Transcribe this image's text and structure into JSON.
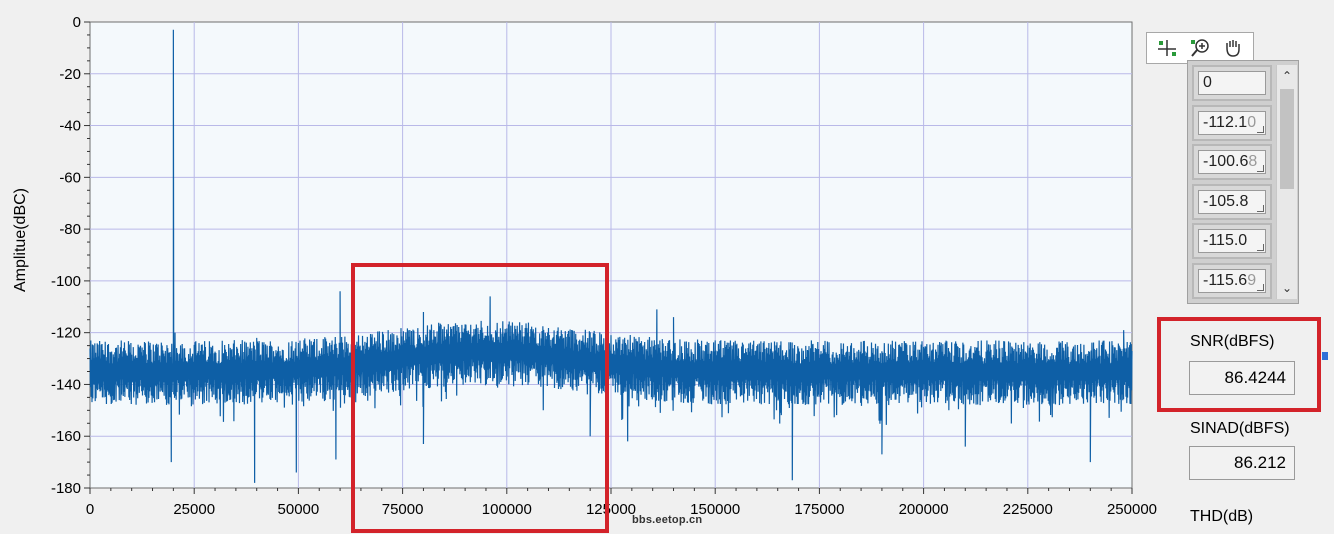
{
  "chart_data": {
    "type": "line",
    "title": "",
    "xlabel": "",
    "ylabel": "Amplitue(dBC)",
    "xlim": [
      0,
      250000
    ],
    "ylim": [
      -180,
      0
    ],
    "x_ticks": [
      0,
      25000,
      50000,
      75000,
      100000,
      125000,
      150000,
      175000,
      200000,
      225000,
      250000
    ],
    "y_ticks": [
      0,
      -20,
      -40,
      -60,
      -80,
      -100,
      -120,
      -140,
      -160,
      -180
    ],
    "x_tick_labels": [
      "0",
      "25000",
      "50000",
      "75000",
      "100000",
      "125000",
      "150000",
      "175000",
      "200000",
      "225000",
      "250000"
    ],
    "y_tick_labels": [
      "0",
      "-20",
      "-40",
      "-60",
      "-80",
      "-100",
      "-120",
      "-140",
      "-160",
      "-180"
    ],
    "grid": true,
    "line_color": "#0e5fa6",
    "plot_background": "#f4f9fc",
    "grid_color": "#b9b9e8",
    "noise_floor": {
      "baseline_db": -136,
      "band_hump_center": 95000,
      "band_hump_db": -128
    },
    "peaks": [
      {
        "x": 20000,
        "y": -3
      },
      {
        "x": 20400,
        "y": -120
      },
      {
        "x": 40000,
        "y": -122
      },
      {
        "x": 60000,
        "y": -104
      },
      {
        "x": 80000,
        "y": -112
      },
      {
        "x": 96000,
        "y": -106
      },
      {
        "x": 136000,
        "y": -111
      },
      {
        "x": 140000,
        "y": -114
      },
      {
        "x": 248000,
        "y": -119
      }
    ],
    "dips": [
      {
        "x": 19500,
        "y": -170
      },
      {
        "x": 39500,
        "y": -178
      },
      {
        "x": 49500,
        "y": -174
      },
      {
        "x": 59000,
        "y": -169
      },
      {
        "x": 80000,
        "y": -163
      },
      {
        "x": 120000,
        "y": -160
      },
      {
        "x": 129000,
        "y": -162
      },
      {
        "x": 168500,
        "y": -177
      },
      {
        "x": 190000,
        "y": -167
      },
      {
        "x": 210000,
        "y": -164
      },
      {
        "x": 240000,
        "y": -170
      }
    ],
    "highlight_region": {
      "x_start": 63000,
      "x_end": 124500
    }
  },
  "toolbar": {
    "items": [
      {
        "name": "cursor-move-icon"
      },
      {
        "name": "zoom-icon"
      },
      {
        "name": "pan-hand-icon"
      }
    ]
  },
  "array": {
    "values": [
      {
        "text": "0",
        "fade": ""
      },
      {
        "text": "-112.1",
        "fade": "0"
      },
      {
        "text": "-100.6",
        "fade": "8"
      },
      {
        "text": "-105.8",
        "fade": ""
      },
      {
        "text": "-115.0",
        "fade": ""
      },
      {
        "text": "-115.6",
        "fade": "9"
      }
    ]
  },
  "indicators": {
    "snr": {
      "label": "SNR(dBFS)",
      "value": "86.4244"
    },
    "sinad": {
      "label": "SINAD(dBFS)",
      "value": "86.212"
    },
    "thd": {
      "label": "THD(dB)"
    }
  },
  "highlight_color": "#d3232a",
  "watermark": "bbs.eetop.cn"
}
